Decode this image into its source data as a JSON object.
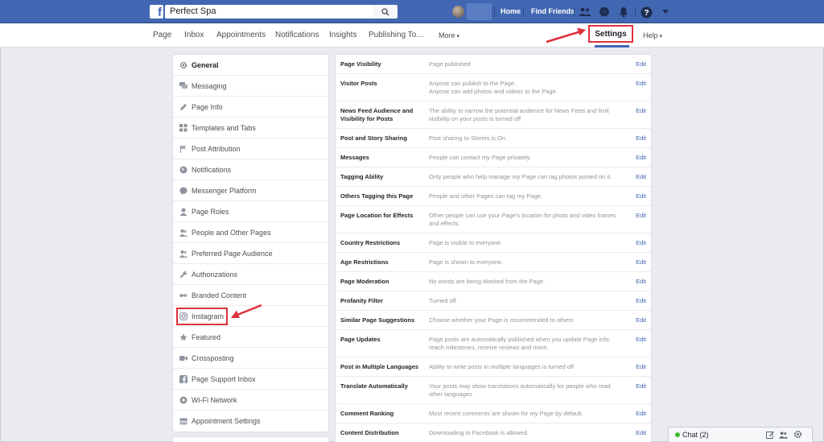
{
  "topbar": {
    "search_value": "Perfect Spa",
    "links": [
      "Home",
      "Find Friends"
    ],
    "icons": [
      "friends-icon",
      "messenger-icon",
      "bell-icon",
      "help-icon",
      "dropdown-icon"
    ]
  },
  "tabs": {
    "items": [
      "Page",
      "Inbox",
      "Appointments",
      "Notifications",
      "Insights",
      "Publishing To…",
      "More"
    ],
    "settings": "Settings",
    "help": "Help"
  },
  "sidebar": {
    "items": [
      {
        "label": "General",
        "icon": "gear-icon",
        "active": true
      },
      {
        "label": "Messaging",
        "icon": "chat-icon"
      },
      {
        "label": "Page Info",
        "icon": "pencil-icon"
      },
      {
        "label": "Templates and Tabs",
        "icon": "grid-icon"
      },
      {
        "label": "Post Attribution",
        "icon": "flag-icon"
      },
      {
        "label": "Notifications",
        "icon": "globe-icon"
      },
      {
        "label": "Messenger Platform",
        "icon": "messenger-icon"
      },
      {
        "label": "Page Roles",
        "icon": "person-icon"
      },
      {
        "label": "People and Other Pages",
        "icon": "people-icon"
      },
      {
        "label": "Preferred Page Audience",
        "icon": "people-icon"
      },
      {
        "label": "Authorizations",
        "icon": "wrench-icon"
      },
      {
        "label": "Branded Content",
        "icon": "branded-icon"
      },
      {
        "label": "Instagram",
        "icon": "instagram-icon"
      },
      {
        "label": "Featured",
        "icon": "star-icon"
      },
      {
        "label": "Crossposting",
        "icon": "video-icon"
      },
      {
        "label": "Page Support Inbox",
        "icon": "fb-icon"
      },
      {
        "label": "Wi-Fi Network",
        "icon": "location-icon"
      },
      {
        "label": "Appointment Settings",
        "icon": "calendar-icon"
      }
    ]
  },
  "settings": {
    "edit_label": "Edit",
    "rows": [
      {
        "label": [
          "Page Visibility"
        ],
        "desc": [
          "Page published"
        ]
      },
      {
        "label": [
          "Visitor Posts"
        ],
        "desc": [
          "Anyone can publish to the Page.",
          "Anyone can add photos and videos to the Page."
        ]
      },
      {
        "label": [
          "News Feed Audience and",
          "Visibility for Posts"
        ],
        "desc": [
          "The ability to narrow the potential audience for News Feed and limit",
          "visibility on your posts is turned off"
        ]
      },
      {
        "label": [
          "Post and Story Sharing"
        ],
        "desc": [
          "Post sharing to Stories is On"
        ]
      },
      {
        "label": [
          "Messages"
        ],
        "desc": [
          "People can contact my Page privately."
        ]
      },
      {
        "label": [
          "Tagging Ability"
        ],
        "desc": [
          "Only people who help manage my Page can tag photos posted on it."
        ]
      },
      {
        "label": [
          "Others Tagging this Page"
        ],
        "desc": [
          "People and other Pages can tag my Page."
        ]
      },
      {
        "label": [
          "Page Location for Effects"
        ],
        "desc": [
          "Other people can use your Page's location for photo and video frames",
          "and effects."
        ]
      },
      {
        "label": [
          "Country Restrictions"
        ],
        "desc": [
          "Page is visible to everyone."
        ]
      },
      {
        "label": [
          "Age Restrictions"
        ],
        "desc": [
          "Page is shown to everyone."
        ]
      },
      {
        "label": [
          "Page Moderation"
        ],
        "desc": [
          "No words are being blocked from the Page."
        ]
      },
      {
        "label": [
          "Profanity Filter"
        ],
        "desc": [
          "Turned off"
        ]
      },
      {
        "label": [
          "Similar Page Suggestions"
        ],
        "desc": [
          "Choose whether your Page is recommended to others"
        ]
      },
      {
        "label": [
          "Page Updates"
        ],
        "desc": [
          "Page posts are automatically published when you update Page info,",
          "reach milestones, receive reviews and more."
        ]
      },
      {
        "label": [
          "Post in Multiple Languages"
        ],
        "desc": [
          "Ability to write posts in multiple languages is turned off"
        ]
      },
      {
        "label": [
          "Translate Automatically"
        ],
        "desc": [
          "Your posts may show translations automatically for people who read",
          "other languages"
        ]
      },
      {
        "label": [
          "Comment Ranking"
        ],
        "desc": [
          "Most recent comments are shown for my Page by default."
        ]
      },
      {
        "label": [
          "Content Distribution"
        ],
        "desc": [
          "Downloading to Facebook is allowed."
        ]
      }
    ]
  },
  "chat": {
    "label": "Chat (2)"
  },
  "colors": {
    "brand": "#4267b2",
    "highlight": "#e0313c",
    "online": "#42b72a"
  }
}
